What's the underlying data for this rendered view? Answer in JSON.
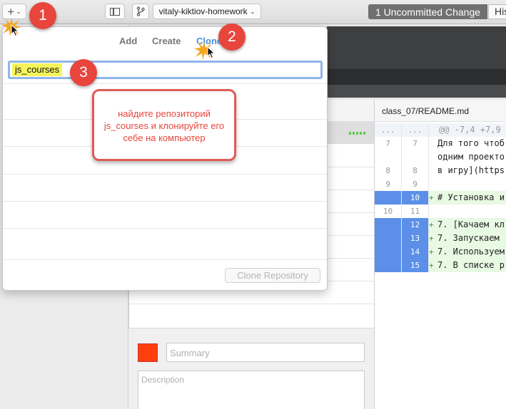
{
  "toolbar": {
    "add_button_symbol": "+",
    "add_button_chevron": "⌄",
    "branch_name": "vitaly-kiktiov-homework",
    "uncommitted_label": "1 Uncommitted Change",
    "history_label": "His"
  },
  "popover": {
    "tabs": {
      "add": "Add",
      "create": "Create",
      "clone": "Clone"
    },
    "filter_value": "js_courses",
    "clone_button": "Clone Repository"
  },
  "commit": {
    "summary_placeholder": "Summary",
    "description_placeholder": "Description"
  },
  "diff": {
    "file_path": "class_07/README.md",
    "lines": [
      {
        "old": "...",
        "new": "...",
        "text": "@@ -7,4 +7,9",
        "kind": "hunk"
      },
      {
        "old": "7",
        "new": "7",
        "text": "Для того чтоб",
        "kind": "context"
      },
      {
        "old": "",
        "new": "",
        "text": "одним проекто",
        "kind": "context"
      },
      {
        "old": "8",
        "new": "8",
        "text": "в игру](https",
        "kind": "context"
      },
      {
        "old": "9",
        "new": "9",
        "text": "",
        "kind": "context"
      },
      {
        "old": "",
        "new": "10",
        "text": "# Установка и",
        "kind": "added"
      },
      {
        "old": "10",
        "new": "11",
        "text": "",
        "kind": "context"
      },
      {
        "old": "",
        "new": "12",
        "text": "7. [Качаем кл",
        "kind": "added"
      },
      {
        "old": "",
        "new": "13",
        "text": "7. Запускаем",
        "kind": "added"
      },
      {
        "old": "",
        "new": "14",
        "text": "7. Используем",
        "kind": "added"
      },
      {
        "old": "",
        "new": "15",
        "text": "7. В списке р",
        "kind": "added"
      }
    ]
  },
  "annotations": {
    "step1": "1",
    "step2": "2",
    "step3": "3",
    "callout_text": "найдите репозиторий js_courses и клонируйте его себе на компьютер"
  },
  "colors": {
    "accent_blue": "#4a90d9",
    "step_red": "#e8453c",
    "added_line_blue": "#5b8fe8",
    "highlight_yellow": "#f5f55a"
  }
}
